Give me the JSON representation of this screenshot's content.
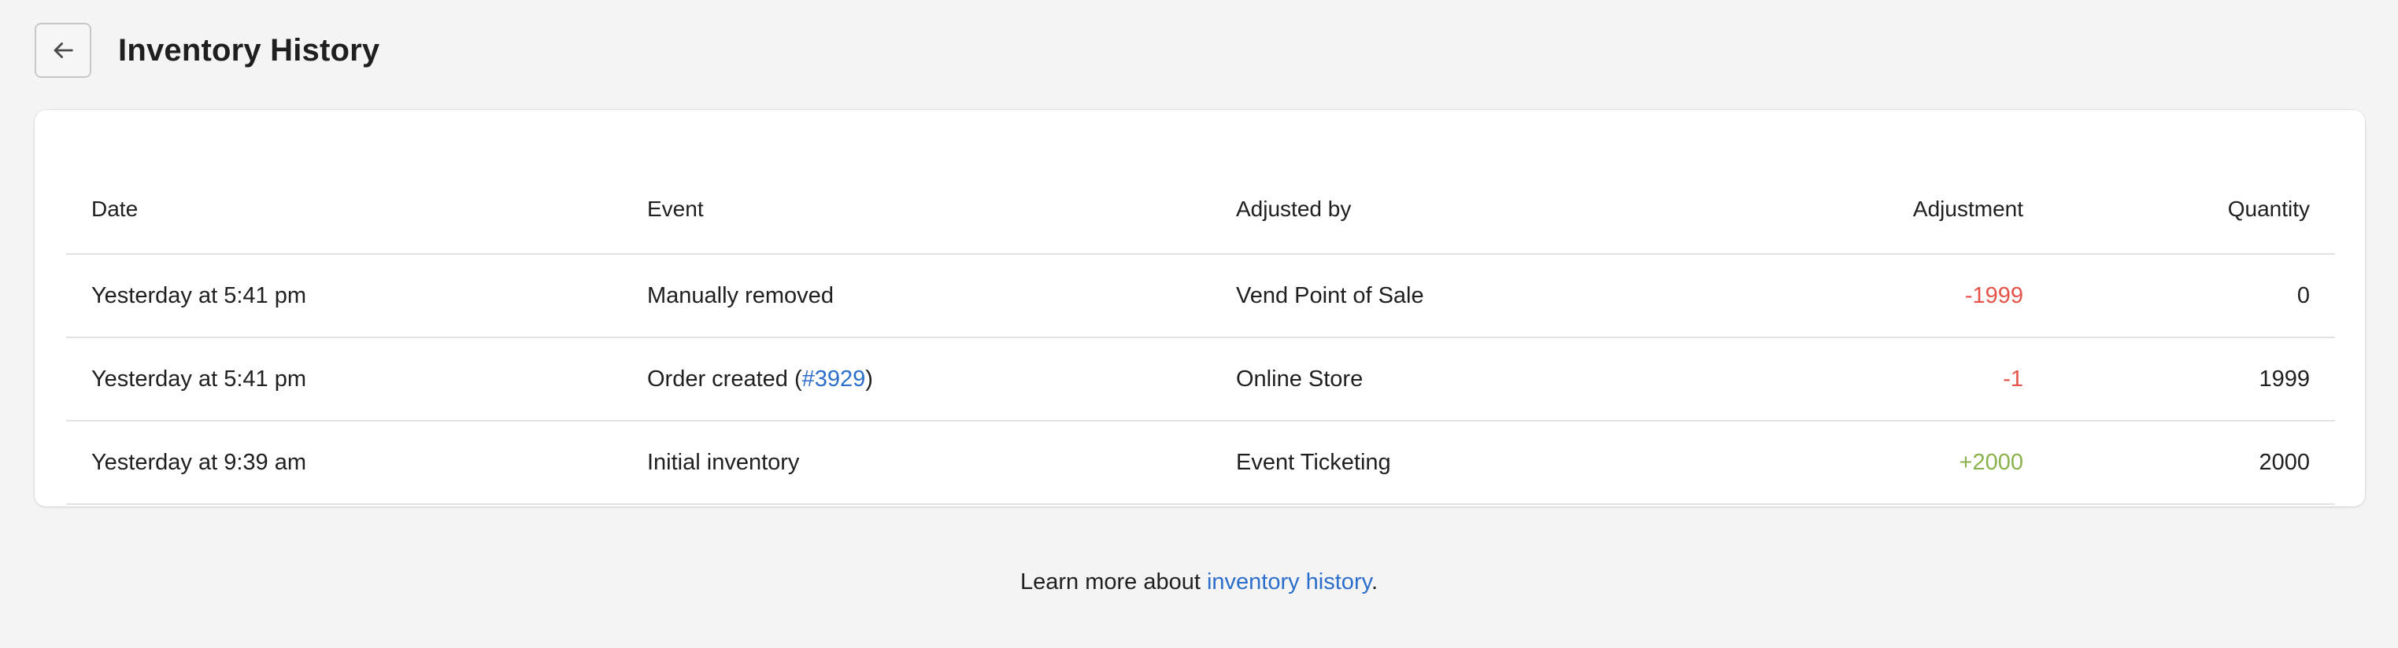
{
  "header": {
    "back_icon": "arrow-left-icon",
    "title": "Inventory History"
  },
  "table": {
    "columns": {
      "date": "Date",
      "event": "Event",
      "adjusted_by": "Adjusted by",
      "adjustment": "Adjustment",
      "quantity": "Quantity"
    },
    "rows": [
      {
        "date": "Yesterday at 5:41 pm",
        "event": "Manually removed",
        "adjusted_by": "Vend Point of Sale",
        "adjustment": "-1999",
        "quantity": "0"
      },
      {
        "date": "Yesterday at 5:41 pm",
        "event_prefix": "Order created (",
        "event_link": "#3929",
        "event_suffix": ")",
        "adjusted_by": "Online Store",
        "adjustment": "-1",
        "quantity": "1999"
      },
      {
        "date": "Yesterday at 9:39 am",
        "event": "Initial inventory",
        "adjusted_by": "Event Ticketing",
        "adjustment": "+2000",
        "quantity": "2000"
      }
    ]
  },
  "footer": {
    "prefix": "Learn more about ",
    "link": "inventory history",
    "suffix": "."
  },
  "colors": {
    "negative": "#e5534b",
    "positive": "#8ab24f",
    "link": "#2c6ecb",
    "background": "#f4f4f4"
  }
}
